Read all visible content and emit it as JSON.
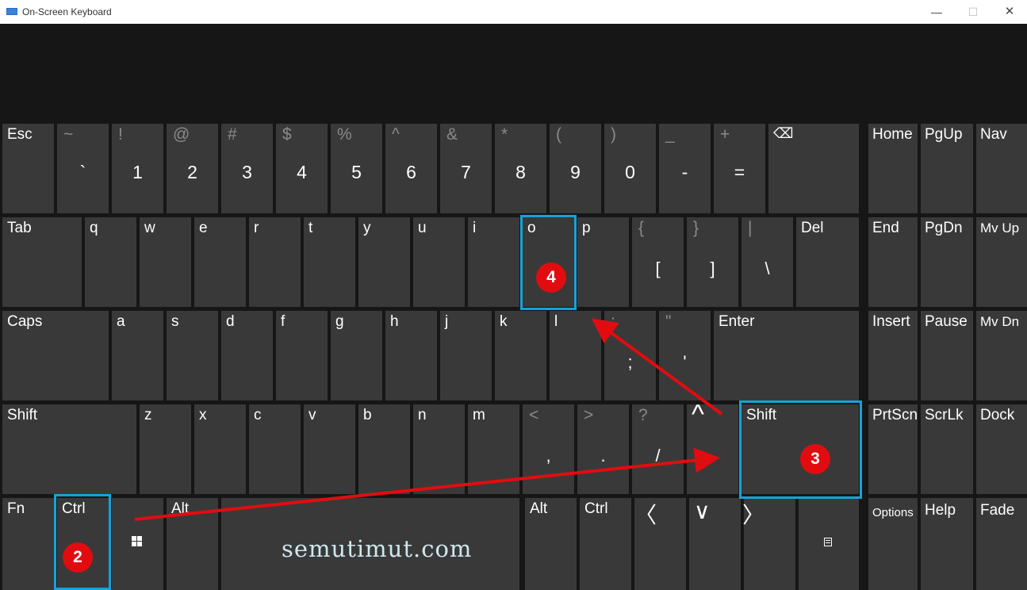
{
  "window": {
    "title": "On-Screen Keyboard",
    "minimize_glyph": "—",
    "maximize_glyph": "☐",
    "close_glyph": "✕"
  },
  "keys": {
    "esc": "Esc",
    "r1": [
      {
        "top": "~",
        "bot": "`"
      },
      {
        "top": "!",
        "bot": "1"
      },
      {
        "top": "@",
        "bot": "2"
      },
      {
        "top": "#",
        "bot": "3"
      },
      {
        "top": "$",
        "bot": "4"
      },
      {
        "top": "%",
        "bot": "5"
      },
      {
        "top": "^",
        "bot": "6"
      },
      {
        "top": "&",
        "bot": "7"
      },
      {
        "top": "*",
        "bot": "8"
      },
      {
        "top": "(",
        "bot": "9"
      },
      {
        "top": ")",
        "bot": "0"
      },
      {
        "top": "_",
        "bot": "-"
      },
      {
        "top": "+",
        "bot": "="
      }
    ],
    "backspace_icon": "backspace-icon",
    "tab": "Tab",
    "r2_letters": [
      "q",
      "w",
      "e",
      "r",
      "t",
      "y",
      "u",
      "i",
      "o",
      "p"
    ],
    "r2_brackets": [
      {
        "top": "{",
        "bot": "["
      },
      {
        "top": "}",
        "bot": "]"
      },
      {
        "top": "|",
        "bot": "\\"
      }
    ],
    "del": "Del",
    "caps": "Caps",
    "r3_letters": [
      "a",
      "s",
      "d",
      "f",
      "g",
      "h",
      "j",
      "k",
      "l"
    ],
    "r3_punct": [
      {
        "top": ":",
        "bot": ";"
      },
      {
        "top": "\"",
        "bot": "'"
      }
    ],
    "enter": "Enter",
    "shift_left": "Shift",
    "r4_letters": [
      "z",
      "x",
      "c",
      "v",
      "b",
      "n",
      "m"
    ],
    "r4_punct": [
      {
        "top": "<",
        "bot": ","
      },
      {
        "top": ">",
        "bot": "."
      },
      {
        "top": "?",
        "bot": "/"
      }
    ],
    "up_arrow": "^",
    "shift_right": "Shift",
    "fn": "Fn",
    "ctrl_left": "Ctrl",
    "win_icon": "windows-icon",
    "alt_left": "Alt",
    "alt_right": "Alt",
    "ctrl_right": "Ctrl",
    "left_arrow": "〈",
    "down_arrow": "∨",
    "right_arrow": "〉",
    "menu_icon": "context-menu-icon",
    "nav": [
      [
        "Home",
        "PgUp",
        "Nav"
      ],
      [
        "End",
        "PgDn",
        "Mv Up"
      ],
      [
        "Insert",
        "Pause",
        "Mv Dn"
      ],
      [
        "PrtScn",
        "ScrLk",
        "Dock"
      ],
      [
        "Options",
        "Help",
        "Fade"
      ]
    ]
  },
  "annotations": {
    "badges": [
      "2",
      "3",
      "4"
    ],
    "highlight_color": "#14a3dc",
    "arrow_color": "#e20c10"
  },
  "watermark": "semutimut.com"
}
